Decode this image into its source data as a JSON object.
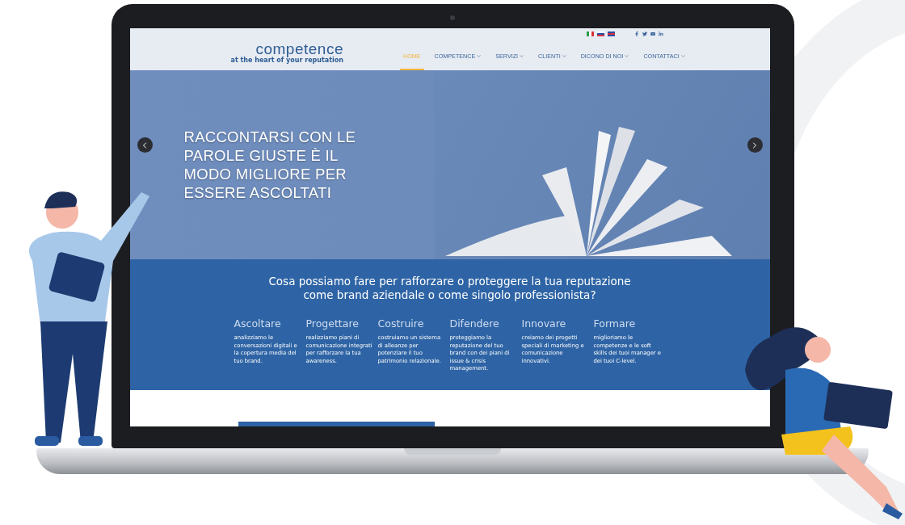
{
  "header": {
    "logo": "competence",
    "tagline": "at the heart of your reputation",
    "languages": [
      {
        "kind": "it"
      },
      {
        "kind": "ru"
      },
      {
        "kind": "en"
      }
    ],
    "social": [
      {
        "kind": "facebook"
      },
      {
        "kind": "twitter"
      },
      {
        "kind": "youtube"
      },
      {
        "kind": "linkedin"
      }
    ],
    "nav": [
      {
        "label": "HOME",
        "selected": true,
        "dropdown": false
      },
      {
        "label": "COMPETENCE",
        "selected": false,
        "dropdown": true
      },
      {
        "label": "SERVIZI",
        "selected": false,
        "dropdown": true
      },
      {
        "label": "CLIENTI",
        "selected": false,
        "dropdown": true
      },
      {
        "label": "DICONO DI NOI",
        "selected": false,
        "dropdown": true
      },
      {
        "label": "CONTATTACI",
        "selected": false,
        "dropdown": true
      }
    ]
  },
  "hero": {
    "headline": "RACCONTARSI CON LE PAROLE GIUSTE È IL MODO MIGLIORE PER ESSERE ASCOLTATI"
  },
  "services": {
    "heading": "Cosa possiamo fare per rafforzare o proteggere la tua reputazione come brand aziendale o come singolo professionista?",
    "items": [
      {
        "title": "Ascoltare",
        "text": "analizziamo le conversazioni digitali e la copertura media del tuo brand."
      },
      {
        "title": "Progettare",
        "text": "realizziamo piani di comunicazione integrati per rafforzare la tua awareness."
      },
      {
        "title": "Costruire",
        "text": "costruiamo un sistema di alleanze per potenziare il tuo patrimonio relazionale."
      },
      {
        "title": "Difendere",
        "text": "proteggiamo la reputazione del tuo brand con dei piani di issue & crisis management."
      },
      {
        "title": "Innovare",
        "text": "creiamo dei progetti speciali di marketing e comunicazione innovativi."
      },
      {
        "title": "Formare",
        "text": "miglioriamo le competenze e le soft skills dei tuoi manager e dei tuoi C-level."
      }
    ]
  }
}
